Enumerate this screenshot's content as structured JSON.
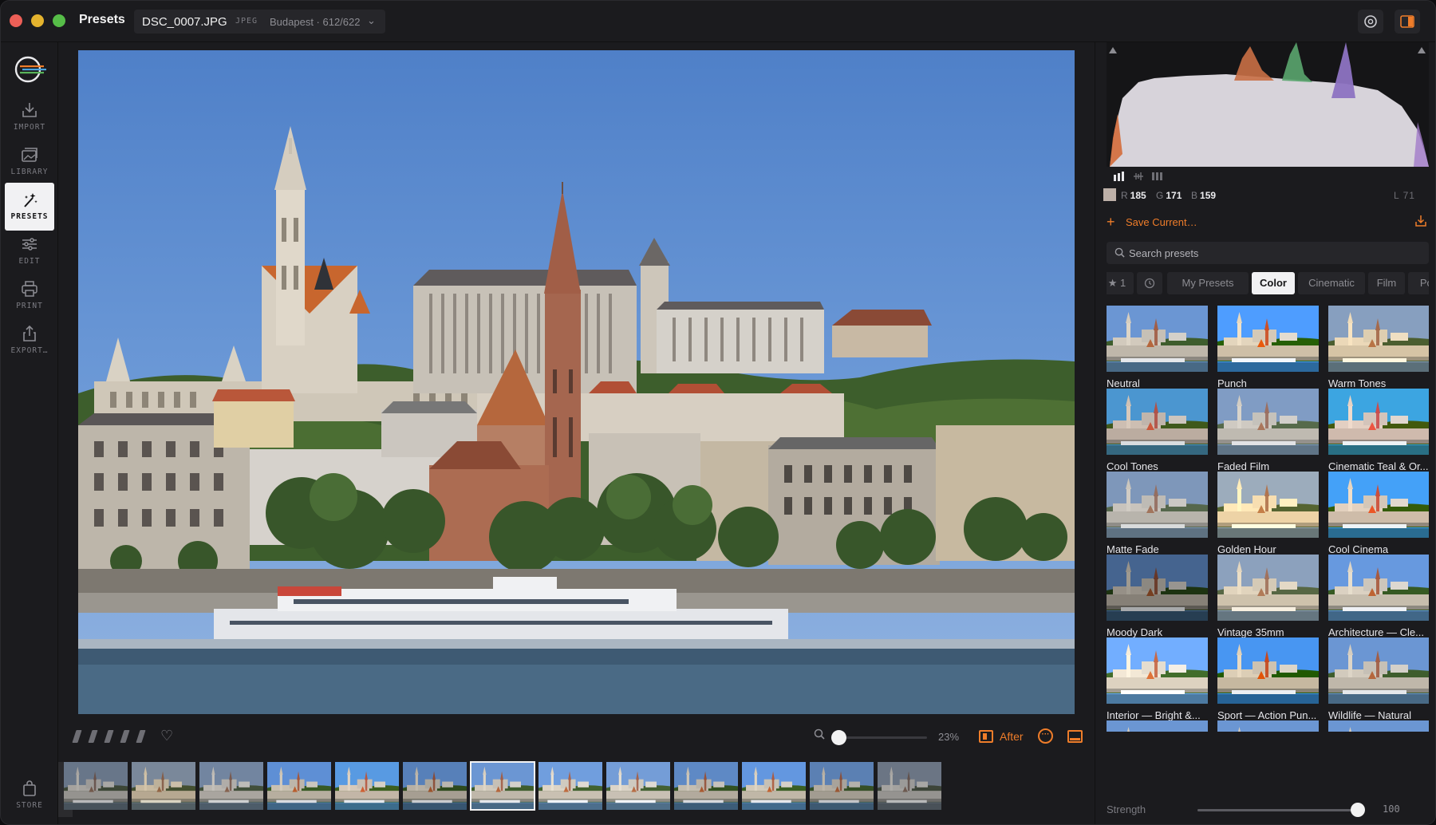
{
  "app": {
    "title": "Presets"
  },
  "file": {
    "name": "DSC_0007.JPG",
    "type": "JPEG",
    "location": "Budapest · 612/622"
  },
  "sidebar": {
    "items": [
      {
        "label": "IMPORT",
        "icon": "import-icon"
      },
      {
        "label": "LIBRARY",
        "icon": "library-icon"
      },
      {
        "label": "PRESETS",
        "icon": "magic-wand-icon",
        "active": true
      },
      {
        "label": "EDIT",
        "icon": "sliders-icon"
      },
      {
        "label": "PRINT",
        "icon": "printer-icon"
      },
      {
        "label": "EXPORT…",
        "icon": "share-icon"
      }
    ],
    "store_label": "STORE"
  },
  "toolbar": {
    "rating": 0,
    "zoom": "23%",
    "view_mode": "After"
  },
  "filmstrip": {
    "count": 13,
    "selected_index": 6
  },
  "histogram": {
    "readout": {
      "r_label": "R",
      "r": "185",
      "g_label": "G",
      "g": "171",
      "b_label": "B",
      "b": "159",
      "l": "L 71"
    },
    "swatch_color": "#bdb0a8"
  },
  "presets_panel": {
    "save_label": "Save Current…",
    "search_placeholder": "Search presets",
    "tabs": [
      {
        "label": "★ 1"
      },
      {
        "label": ""
      },
      {
        "label": "My Presets"
      },
      {
        "label": "Color",
        "active": true
      },
      {
        "label": "Cinematic"
      },
      {
        "label": "Film"
      },
      {
        "label": "Por"
      }
    ],
    "presets": [
      {
        "name": "Neutral",
        "tint": "none"
      },
      {
        "name": "Punch",
        "tint": "punch"
      },
      {
        "name": "Warm Tones",
        "tint": "warm"
      },
      {
        "name": "Cool Tones",
        "tint": "cool"
      },
      {
        "name": "Faded Film",
        "tint": "faded"
      },
      {
        "name": "Cinematic Teal & Or...",
        "tint": "teal"
      },
      {
        "name": "Matte Fade",
        "tint": "matte"
      },
      {
        "name": "Golden Hour",
        "tint": "golden"
      },
      {
        "name": "Cool Cinema",
        "tint": "coolcinema"
      },
      {
        "name": "Moody Dark",
        "tint": "moody"
      },
      {
        "name": "Vintage 35mm",
        "tint": "vintage"
      },
      {
        "name": "Architecture — Cle...",
        "tint": "arch"
      },
      {
        "name": "Interior — Bright &...",
        "tint": "bright"
      },
      {
        "name": "Sport — Action Pun...",
        "tint": "sport"
      },
      {
        "name": "Wildlife — Natural",
        "tint": "none"
      }
    ],
    "strength_label": "Strength",
    "strength_value": "100"
  },
  "colors": {
    "accent": "#ef7d2a",
    "panel_bg": "#1b1b1e",
    "active_tab_bg": "#f1f1f3"
  }
}
